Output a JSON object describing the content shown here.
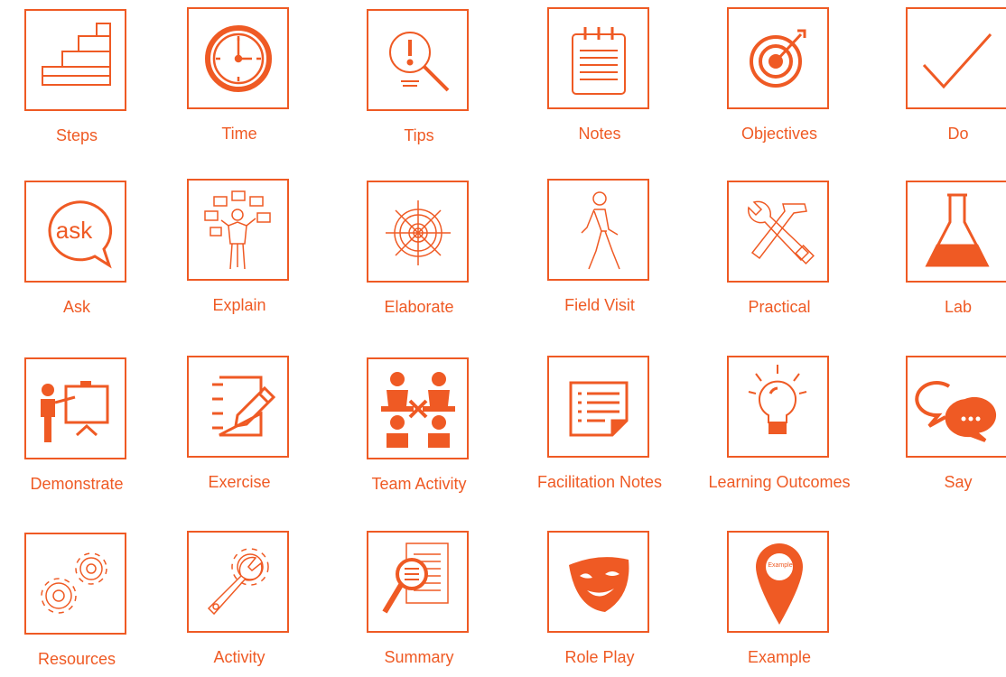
{
  "accent_color": "#ef5a24",
  "icons": [
    {
      "label": "Steps",
      "icon": "steps-icon"
    },
    {
      "label": "Time",
      "icon": "clock-icon"
    },
    {
      "label": "Tips",
      "icon": "tips-icon"
    },
    {
      "label": "Notes",
      "icon": "notes-icon"
    },
    {
      "label": "Objectives",
      "icon": "target-icon"
    },
    {
      "label": "Do",
      "icon": "checkmark-icon"
    },
    {
      "label": "Ask",
      "icon": "ask-bubble-icon"
    },
    {
      "label": "Explain",
      "icon": "explain-person-icon"
    },
    {
      "label": "Elaborate",
      "icon": "ship-wheel-icon"
    },
    {
      "label": "Field Visit",
      "icon": "walking-person-icon"
    },
    {
      "label": "Practical",
      "icon": "tools-icon"
    },
    {
      "label": "Lab",
      "icon": "flask-icon"
    },
    {
      "label": "Demonstrate",
      "icon": "presenter-board-icon"
    },
    {
      "label": "Exercise",
      "icon": "pencil-notepad-icon"
    },
    {
      "label": "Team Activity",
      "icon": "team-people-icon"
    },
    {
      "label": "Facilitation Notes",
      "icon": "document-list-icon"
    },
    {
      "label": "Learning Outcomes",
      "icon": "lightbulb-icon"
    },
    {
      "label": "Say",
      "icon": "speech-bubbles-icon"
    },
    {
      "label": "Resources",
      "icon": "gears-icon"
    },
    {
      "label": "Activity",
      "icon": "wrench-gear-icon"
    },
    {
      "label": "Summary",
      "icon": "magnifier-document-icon"
    },
    {
      "label": "Role Play",
      "icon": "theater-mask-icon"
    },
    {
      "label": "Example",
      "icon": "map-pin-icon",
      "pin_text": "Example"
    }
  ]
}
